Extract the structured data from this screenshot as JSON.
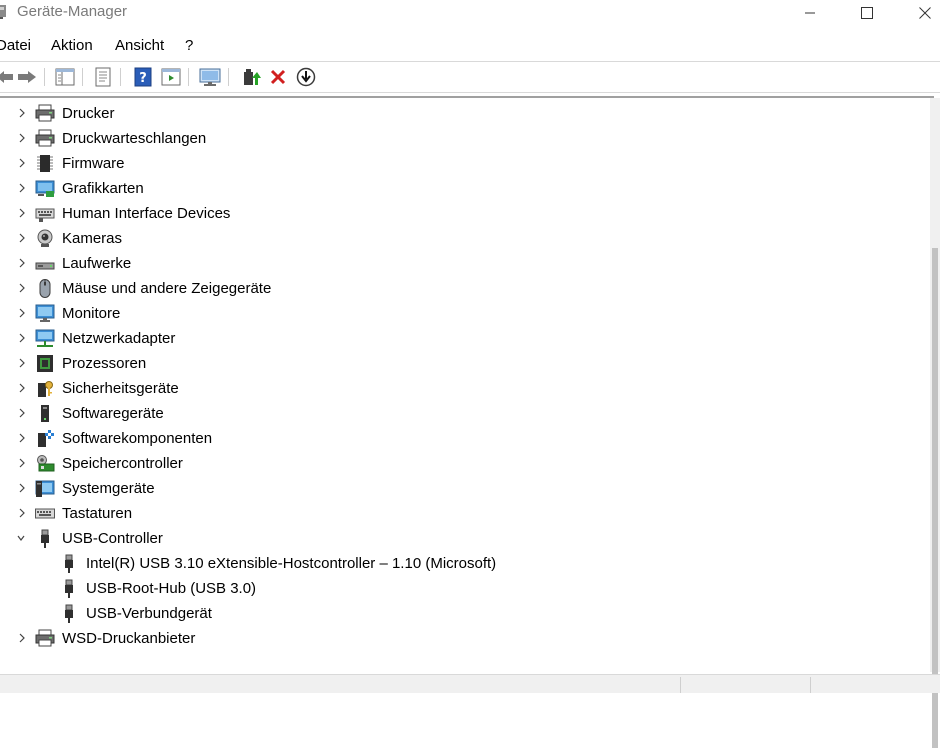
{
  "window": {
    "title": "Geräte-Manager",
    "minimize_icon": "minimize-icon",
    "maximize_icon": "maximize-icon",
    "close_icon": "close-icon"
  },
  "menu": [
    "Datei",
    "Aktion",
    "Ansicht",
    "?"
  ],
  "toolbar": [
    "back-arrow-icon",
    "forward-arrow-icon",
    "show-hide-console-tree-icon",
    "properties-icon",
    "help-icon",
    "action-pane-icon",
    "scan-hardware-icon",
    "update-driver-icon",
    "uninstall-device-icon",
    "disable-device-icon"
  ],
  "tree": [
    {
      "label": "Drucker",
      "icon": "printer-icon",
      "expanded": false
    },
    {
      "label": "Druckwarteschlangen",
      "icon": "printer-icon",
      "expanded": false
    },
    {
      "label": "Firmware",
      "icon": "firmware-chip-icon",
      "expanded": false
    },
    {
      "label": "Grafikkarten",
      "icon": "display-adapter-icon",
      "expanded": false
    },
    {
      "label": "Human Interface Devices",
      "icon": "hid-keyboard-icon",
      "expanded": false
    },
    {
      "label": "Kameras",
      "icon": "webcam-icon",
      "expanded": false
    },
    {
      "label": "Laufwerke",
      "icon": "disk-drive-icon",
      "expanded": false
    },
    {
      "label": "Mäuse und andere Zeigegeräte",
      "icon": "mouse-icon",
      "expanded": false
    },
    {
      "label": "Monitore",
      "icon": "monitor-icon",
      "expanded": false
    },
    {
      "label": "Netzwerkadapter",
      "icon": "network-adapter-icon",
      "expanded": false
    },
    {
      "label": "Prozessoren",
      "icon": "processor-icon",
      "expanded": false
    },
    {
      "label": "Sicherheitsgeräte",
      "icon": "security-device-icon",
      "expanded": false
    },
    {
      "label": "Softwaregeräte",
      "icon": "software-device-icon",
      "expanded": false
    },
    {
      "label": "Softwarekomponenten",
      "icon": "software-component-icon",
      "expanded": false
    },
    {
      "label": "Speichercontroller",
      "icon": "storage-controller-icon",
      "expanded": false
    },
    {
      "label": "Systemgeräte",
      "icon": "system-device-icon",
      "expanded": false
    },
    {
      "label": "Tastaturen",
      "icon": "keyboard-icon",
      "expanded": false
    },
    {
      "label": "USB-Controller",
      "icon": "usb-plug-icon",
      "expanded": true,
      "children": [
        {
          "label": "Intel(R) USB 3.10 eXtensible-Hostcontroller – 1.10 (Microsoft)",
          "icon": "usb-plug-icon"
        },
        {
          "label": "USB-Root-Hub (USB 3.0)",
          "icon": "usb-plug-icon"
        },
        {
          "label": "USB-Verbundgerät",
          "icon": "usb-plug-icon"
        }
      ]
    },
    {
      "label": "WSD-Druckanbieter",
      "icon": "printer-icon",
      "expanded": false
    }
  ]
}
